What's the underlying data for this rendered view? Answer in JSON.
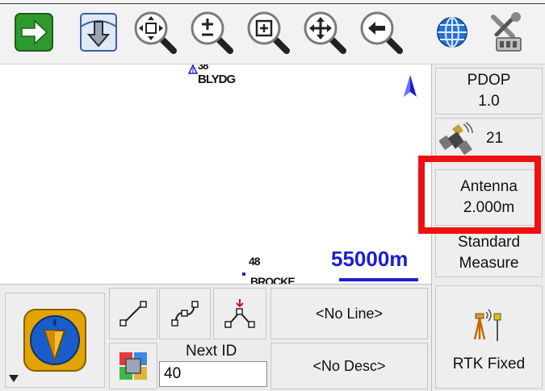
{
  "toolbar": {
    "buttons": [
      {
        "icon": "arrow-right-icon"
      },
      {
        "icon": "download-arrow-icon"
      },
      {
        "icon": "zoom-extents-icon"
      },
      {
        "icon": "zoom-in-out-icon"
      },
      {
        "icon": "zoom-window-icon"
      },
      {
        "icon": "pan-icon"
      },
      {
        "icon": "zoom-previous-icon"
      },
      {
        "icon": "globe-icon"
      },
      {
        "icon": "tools-icon"
      }
    ]
  },
  "map": {
    "point_label_top_number": "38",
    "point_label_top_desc": "BLYDG",
    "point_label_bottom_number": "48",
    "point_label_bottom_desc": "BROCKE",
    "scale_text": "55000m",
    "colors": {
      "scale": "#1a1fd0",
      "north": "#1a1fd0"
    }
  },
  "status": {
    "pdop_label": "PDOP",
    "pdop_value": "1.0",
    "satellite_count": "21",
    "antenna_label": "Antenna",
    "antenna_value": "2.000m",
    "mode_line1": "Standard",
    "mode_line2": "Measure",
    "rtk_status": "RTK Fixed"
  },
  "bottom": {
    "line_button_label": "<No Line>",
    "desc_button_label": "<No Desc>",
    "next_id_label": "Next ID",
    "next_id_value": "40"
  },
  "colors": {
    "highlight": "#ee1111",
    "accent": "#1a1fd0"
  }
}
